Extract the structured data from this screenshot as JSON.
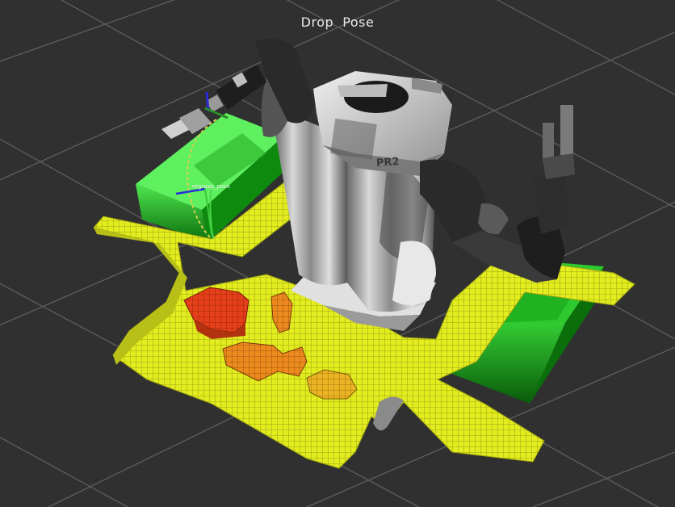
{
  "viewer": {
    "title": "Drop  Pose",
    "markers": {
      "pose_label": "regrasp_pose"
    },
    "robot": {
      "model_label": "PR2"
    },
    "colors": {
      "background": "#303030",
      "grid": "#5a5a5a",
      "table": "#19b519",
      "octomap_low": "#e6ef1e",
      "octomap_high": "#e23a14",
      "robot_body": "#d0d0d0",
      "robot_dark": "#2c2c2c"
    }
  }
}
